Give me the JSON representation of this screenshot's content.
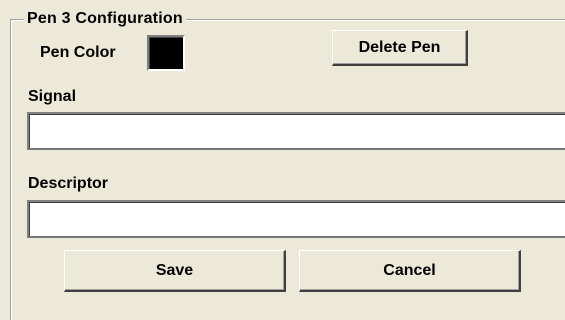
{
  "group": {
    "title": "Pen 3  Configuration"
  },
  "pen_color": {
    "label": "Pen Color",
    "value": "#000000"
  },
  "delete_button": {
    "label": "Delete Pen"
  },
  "signal": {
    "label": "Signal",
    "value": ""
  },
  "descriptor": {
    "label": "Descriptor",
    "value": ""
  },
  "actions": {
    "save_label": "Save",
    "cancel_label": "Cancel"
  },
  "colors": {
    "background": "#ECE9D8",
    "field_background": "#FFFFFF"
  }
}
